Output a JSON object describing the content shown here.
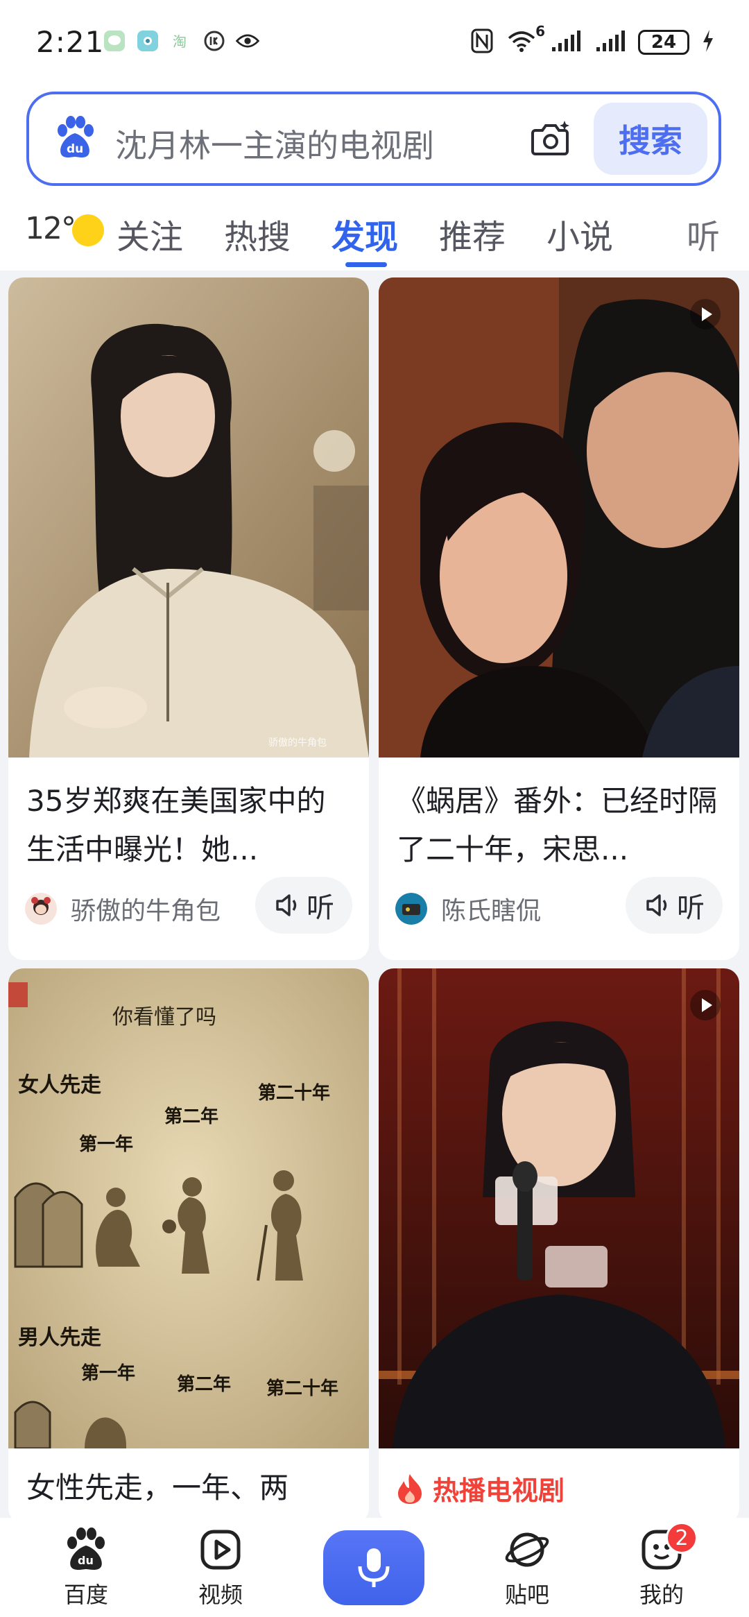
{
  "status_bar": {
    "time": "2:21",
    "battery": "24",
    "network_label": "6"
  },
  "search": {
    "placeholder": "沈月林一主演的电视剧",
    "button_label": "搜索",
    "logo_text": "du"
  },
  "weather": {
    "temperature": "12°"
  },
  "tabs": [
    {
      "label": "关注",
      "active": false
    },
    {
      "label": "热搜",
      "active": false
    },
    {
      "label": "发现",
      "active": true
    },
    {
      "label": "推荐",
      "active": false
    },
    {
      "label": "小说",
      "active": false
    },
    {
      "label": "听",
      "active": false
    }
  ],
  "feed": [
    {
      "title": "35岁郑爽在美国家中的生活中曝光！她...",
      "author": "骄傲的牛角包",
      "listen_label": "听",
      "watermark": "骄傲的牛角包",
      "is_video": false
    },
    {
      "title": "《蜗居》番外：已经时隔了二十年，宋思...",
      "author": "陈氏瞎侃",
      "listen_label": "听",
      "is_video": true
    },
    {
      "title": "女性先走，一年、两",
      "image_text": {
        "question": "你看懂了吗",
        "woman_first": "女人先走",
        "man_first": "男人先走",
        "year1": "第一年",
        "year2": "第二年",
        "year20": "第二十年"
      },
      "is_video": false
    },
    {
      "hot_tag": "热播电视剧",
      "is_video": true
    }
  ],
  "bottom_nav": {
    "items": [
      {
        "label": "百度"
      },
      {
        "label": "视频"
      },
      {
        "label": ""
      },
      {
        "label": "贴吧"
      },
      {
        "label": "我的"
      }
    ],
    "notification_count": "2"
  },
  "colors": {
    "accent": "#4e6ef2",
    "active_tab": "#3164ea",
    "hot": "#f04238"
  }
}
